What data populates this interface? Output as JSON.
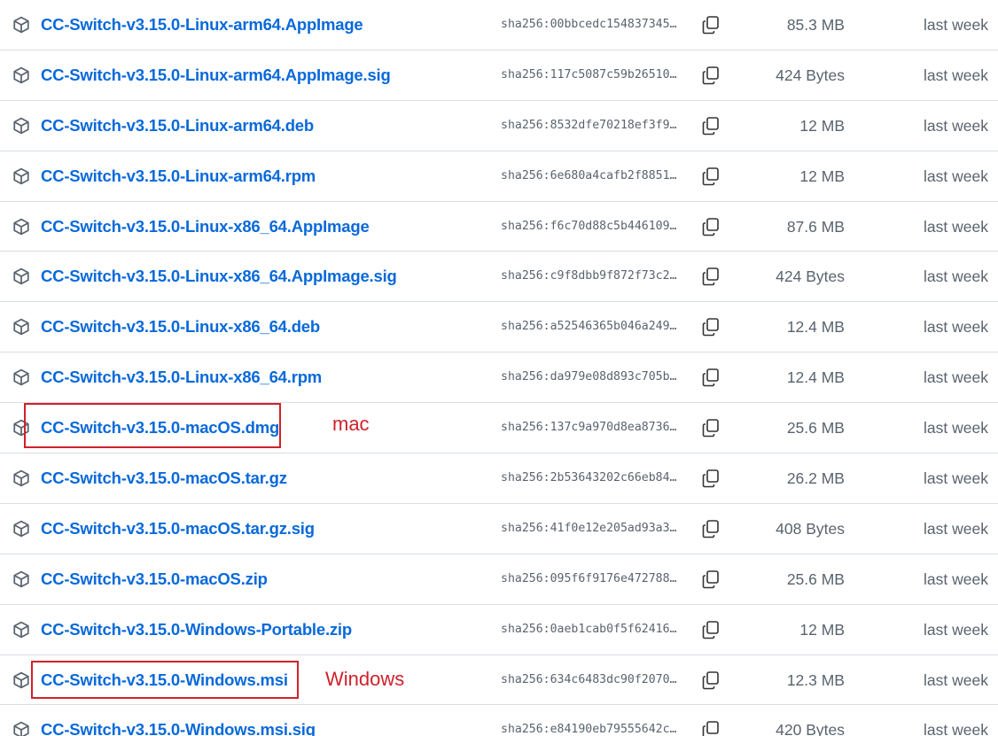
{
  "assets": [
    {
      "name": "CC-Switch-v3.15.0-Linux-arm64.AppImage",
      "sha": "sha256:00bbcedc154837345…",
      "size": "85.3 MB",
      "updated": "last week"
    },
    {
      "name": "CC-Switch-v3.15.0-Linux-arm64.AppImage.sig",
      "sha": "sha256:117c5087c59b26510…",
      "size": "424 Bytes",
      "updated": "last week"
    },
    {
      "name": "CC-Switch-v3.15.0-Linux-arm64.deb",
      "sha": "sha256:8532dfe70218ef3f9…",
      "size": "12 MB",
      "updated": "last week"
    },
    {
      "name": "CC-Switch-v3.15.0-Linux-arm64.rpm",
      "sha": "sha256:6e680a4cafb2f8851…",
      "size": "12 MB",
      "updated": "last week"
    },
    {
      "name": "CC-Switch-v3.15.0-Linux-x86_64.AppImage",
      "sha": "sha256:f6c70d88c5b446109…",
      "size": "87.6 MB",
      "updated": "last week"
    },
    {
      "name": "CC-Switch-v3.15.0-Linux-x86_64.AppImage.sig",
      "sha": "sha256:c9f8dbb9f872f73c2…",
      "size": "424 Bytes",
      "updated": "last week"
    },
    {
      "name": "CC-Switch-v3.15.0-Linux-x86_64.deb",
      "sha": "sha256:a52546365b046a249…",
      "size": "12.4 MB",
      "updated": "last week"
    },
    {
      "name": "CC-Switch-v3.15.0-Linux-x86_64.rpm",
      "sha": "sha256:da979e08d893c705b…",
      "size": "12.4 MB",
      "updated": "last week"
    },
    {
      "name": "CC-Switch-v3.15.0-macOS.dmg",
      "sha": "sha256:137c9a970d8ea8736…",
      "size": "25.6 MB",
      "updated": "last week"
    },
    {
      "name": "CC-Switch-v3.15.0-macOS.tar.gz",
      "sha": "sha256:2b53643202c66eb84…",
      "size": "26.2 MB",
      "updated": "last week"
    },
    {
      "name": "CC-Switch-v3.15.0-macOS.tar.gz.sig",
      "sha": "sha256:41f0e12e205ad93a3…",
      "size": "408 Bytes",
      "updated": "last week"
    },
    {
      "name": "CC-Switch-v3.15.0-macOS.zip",
      "sha": "sha256:095f6f9176e472788…",
      "size": "25.6 MB",
      "updated": "last week"
    },
    {
      "name": "CC-Switch-v3.15.0-Windows-Portable.zip",
      "sha": "sha256:0aeb1cab0f5f62416…",
      "size": "12 MB",
      "updated": "last week"
    },
    {
      "name": "CC-Switch-v3.15.0-Windows.msi",
      "sha": "sha256:634c6483dc90f2070…",
      "size": "12.3 MB",
      "updated": "last week"
    },
    {
      "name": "CC-Switch-v3.15.0-Windows.msi.sig",
      "sha": "sha256:e84190eb79555642c…",
      "size": "420 Bytes",
      "updated": "last week"
    }
  ],
  "annotations": {
    "mac_label": "mac",
    "windows_label": "Windows",
    "color": "#d0212a"
  },
  "colors": {
    "link": "#0969da",
    "muted": "#59636e",
    "border": "#d8dee4"
  },
  "icons": {
    "asset": "package-icon",
    "copy": "copy-icon"
  }
}
